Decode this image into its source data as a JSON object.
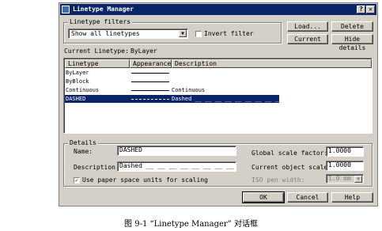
{
  "window": {
    "title": "Linetype Manager",
    "help_btn": "?",
    "close_btn": "✕"
  },
  "filters": {
    "group_label": "Linetype filters",
    "selected": "Show all linetypes",
    "invert_label": "Invert filter",
    "invert_checked": false
  },
  "buttons": {
    "load": "Load...",
    "delete": "Delete",
    "current": "Current",
    "hide_details": "Hide details",
    "ok": "OK",
    "cancel": "Cancel",
    "help": "Help"
  },
  "current_linetype": {
    "label": "Current Linetype:",
    "value": "ByLayer"
  },
  "list": {
    "headers": [
      "Linetype",
      "Appearance",
      "Description"
    ],
    "rows": [
      {
        "name": "ByLayer",
        "description": "",
        "pattern": "solid",
        "selected": false
      },
      {
        "name": "ByBlock",
        "description": "",
        "pattern": "solid",
        "selected": false
      },
      {
        "name": "Continuous",
        "description": "Continuous",
        "pattern": "solid",
        "selected": false
      },
      {
        "name": "DASHED",
        "description": "Dashed __ __ __ __ __ __ __ __ __ __ __ __ __ __ __",
        "pattern": "dashed",
        "selected": true
      }
    ]
  },
  "details": {
    "group_label": "Details",
    "name_label": "Name:",
    "name_value": "DASHED",
    "description_label": "Description:",
    "description_value": "Dashed __ __ __ __ __ __ __ __ __ __",
    "global_scale_label": "Global scale factor:",
    "global_scale_value": "1.0000",
    "object_scale_label": "Current object scale:",
    "object_scale_value": "1.0000",
    "iso_pen_label": "ISO pen width:",
    "iso_pen_value": "1.0 mm",
    "paper_space_label": "Use paper space units for scaling",
    "paper_space_checked": true
  },
  "caption": "图 9-1    “Linetype Manager” 对话框",
  "colors": {
    "face": "#d4d0c8",
    "titlebar": "#0a246a",
    "selection": "#0a246a"
  }
}
